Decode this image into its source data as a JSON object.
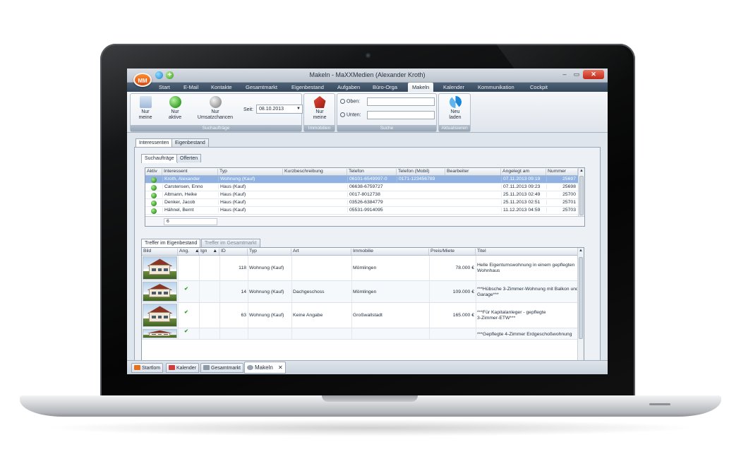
{
  "window": {
    "title": "Makeln - MaXXMedien (Alexander Kroth)",
    "logo": "MM"
  },
  "menu": [
    "Start",
    "E-Mail",
    "Kontakte",
    "Gesamtmarkt",
    "Eigenbestand",
    "Aufgaben",
    "Büro-Orga",
    "Makeln",
    "Kalender",
    "Kommunikation",
    "Cockpit"
  ],
  "menu_active": "Makeln",
  "ribbon": {
    "nur_meine": [
      "Nur",
      "meine"
    ],
    "nur_aktive": [
      "Nur",
      "aktive"
    ],
    "umsatzchancen": [
      "Nur",
      "Umsatzchancen"
    ],
    "seit_label": "Seit:",
    "seit_value": "08.10.2013",
    "group_suchauftraege": "Suchaufträge",
    "immo_nur_meine": [
      "Nur",
      "meine"
    ],
    "group_immobilien": "Immobilien",
    "oben_label": "Oben:",
    "unten_label": "Unten:",
    "group_suche": "Suche",
    "neu_laden": [
      "Neu",
      "laden"
    ],
    "group_aktualisieren": "Aktualisieren"
  },
  "tabs_outer": [
    "Interessenten",
    "Eigenbestand"
  ],
  "tabs_inner": [
    "Suchaufträge",
    "Offerten"
  ],
  "grid1": {
    "headers": [
      "Aktiv",
      "Interessent",
      "Typ",
      "Kurzbeschreibung",
      "Telefon",
      "Telefon (Mobil)",
      "Bearbeiter",
      "Angelegt am",
      "Nummer"
    ],
    "rows": [
      {
        "name": "Kroth, Alexander",
        "typ": "Wohnung (Kauf)",
        "tel": "06101-6549997-0",
        "mobil": "0171-123456789",
        "angelegt": "07.11.2013 09:19",
        "nummer": "25697"
      },
      {
        "name": "Carstensen, Enno",
        "typ": "Haus (Kauf)",
        "tel": "06638-6759727",
        "mobil": "",
        "angelegt": "07.11.2013 09:23",
        "nummer": "25698"
      },
      {
        "name": "Altmann, Heike",
        "typ": "Haus (Kauf)",
        "tel": "0017-8012738",
        "mobil": "",
        "angelegt": "25.11.2013 02:49",
        "nummer": "25700"
      },
      {
        "name": "Denker, Jacob",
        "typ": "Haus (Kauf)",
        "tel": "03526-6384779",
        "mobil": "",
        "angelegt": "25.11.2013 02:51",
        "nummer": "25701"
      },
      {
        "name": "Hähnel, Bernt",
        "typ": "Haus (Kauf)",
        "tel": "05531-9914095",
        "mobil": "",
        "angelegt": "11.12.2013 04:59",
        "nummer": "25703"
      }
    ],
    "count": "6"
  },
  "tabs_treffer": [
    "Treffer im Eigenbestand",
    "Treffer im Gesamtmarkt"
  ],
  "grid2": {
    "headers": [
      "Bild",
      "Ang.",
      "Ign",
      "ID",
      "Typ",
      "Art",
      "Immobilie",
      "Preis/Miete",
      "Titel"
    ],
    "rows": [
      {
        "checked": false,
        "id": "118",
        "typ": "Wohnung (Kauf)",
        "art": "",
        "immobilie": "Mömlingen",
        "preis": "78.000 €",
        "titel": [
          "Helle Eigentumswohnung in einem gepflegten",
          "Wohnhaus"
        ]
      },
      {
        "checked": true,
        "id": "14",
        "typ": "Wohnung (Kauf)",
        "art": "Dachgeschoss",
        "immobilie": "Mömlingen",
        "preis": "109.000 €",
        "titel": [
          "***Hübsche 3-Zimmer-Wohnung mit Balkon und",
          "Garage***"
        ]
      },
      {
        "checked": true,
        "id": "63",
        "typ": "Wohnung (Kauf)",
        "art": "Keine Angabe",
        "immobilie": "Großwallstadt",
        "preis": "165.000 €",
        "titel": [
          "***Für Kapitalanleger - gepflegte",
          "3-Zimmer-ETW***"
        ]
      },
      {
        "checked": true,
        "id": "",
        "typ": "",
        "art": "",
        "immobilie": "",
        "preis": "",
        "titel": [
          "***Gepflegte 4-Zimmer Erdgeschoßwohnung",
          ""
        ]
      }
    ],
    "count": "4"
  },
  "doc_tabs": [
    "Startlom",
    "Kalender",
    "Gesamtmarkt",
    "Makeln"
  ],
  "doc_tab_close": "✕"
}
